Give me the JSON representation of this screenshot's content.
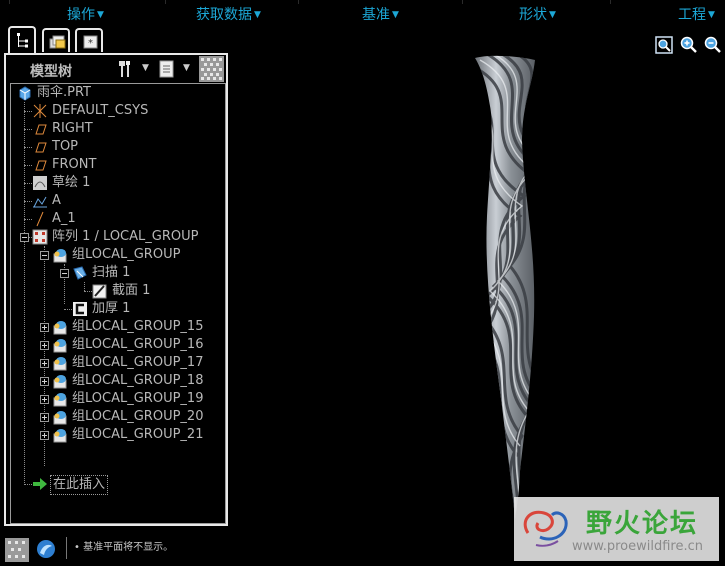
{
  "menu": {
    "items": [
      "操作",
      "获取数据",
      "基准",
      "形状",
      "工程"
    ]
  },
  "panel": {
    "title": "模型树"
  },
  "tree": {
    "root": "雨伞.PRT",
    "csys": "DEFAULT_CSYS",
    "right": "RIGHT",
    "top": "TOP",
    "front": "FRONT",
    "sketch": "草绘 1",
    "point": "A",
    "axis": "A_1",
    "pattern": "阵列 1 / LOCAL_GROUP",
    "group": "组LOCAL_GROUP",
    "sweep": "扫描 1",
    "section": "截面 1",
    "thicken": "加厚 1",
    "groups": [
      "组LOCAL_GROUP_15",
      "组LOCAL_GROUP_16",
      "组LOCAL_GROUP_17",
      "组LOCAL_GROUP_18",
      "组LOCAL_GROUP_19",
      "组LOCAL_GROUP_20",
      "组LOCAL_GROUP_21"
    ],
    "insert": "在此插入"
  },
  "status": {
    "message": "• 基准平面将不显示。"
  },
  "watermark": {
    "title": "野火论坛",
    "url": "www.proewildfire.cn"
  },
  "colors": {
    "menu_text": "#1ca7d6",
    "background": "#000000",
    "model": "#b9bec4",
    "watermark_green": "#3aa53a"
  }
}
